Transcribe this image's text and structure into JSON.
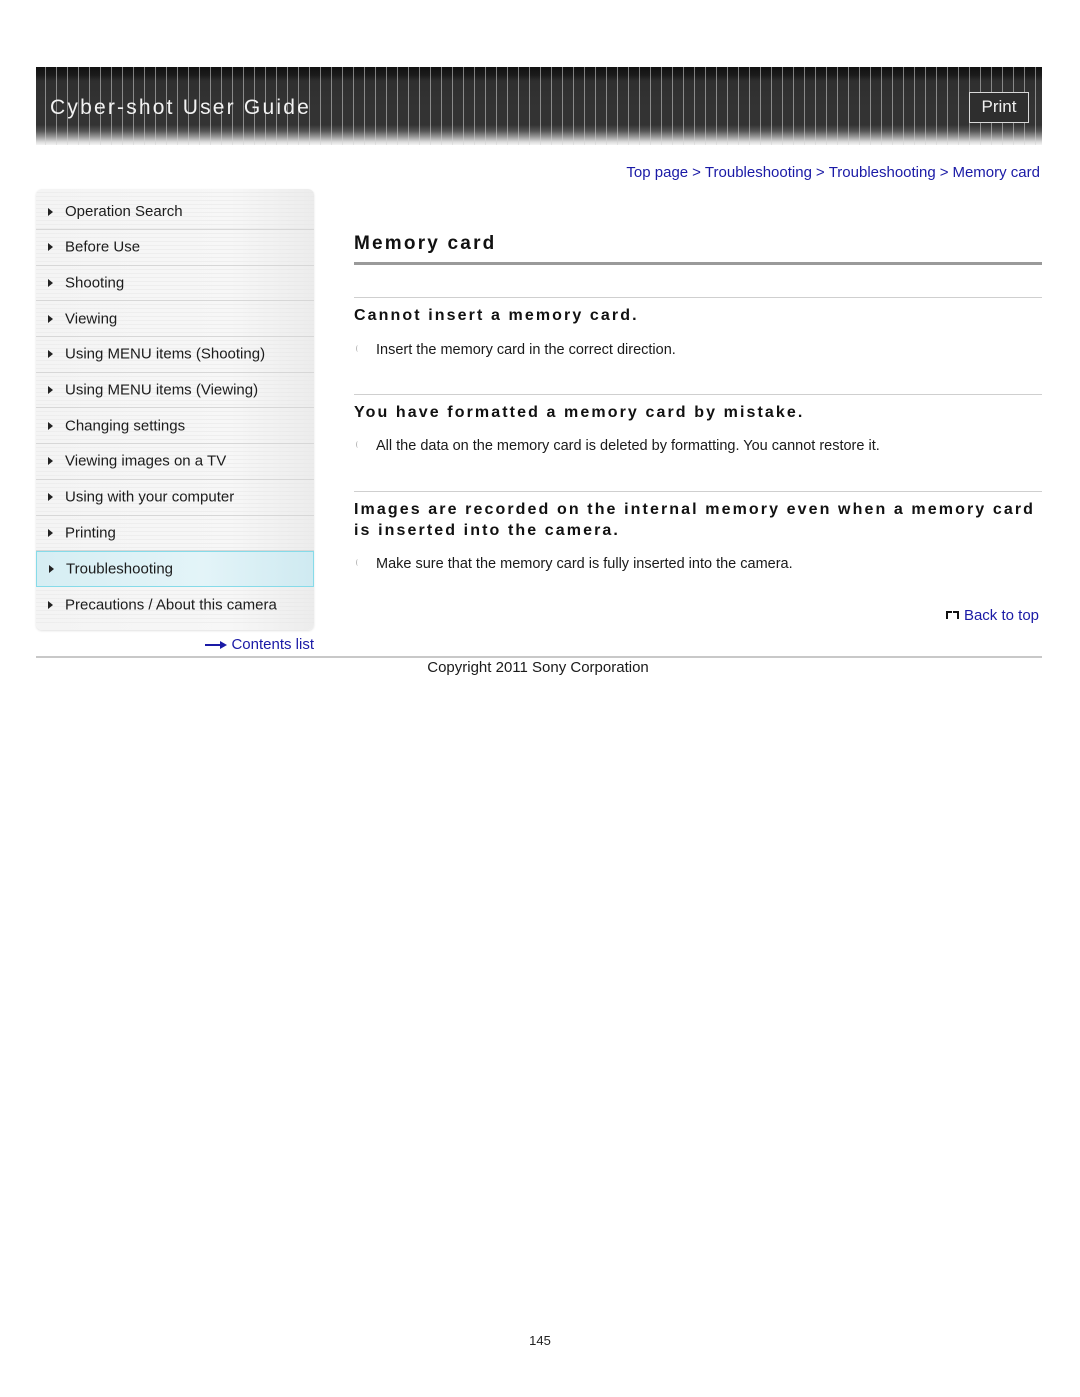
{
  "header": {
    "title": "Cyber-shot User Guide",
    "print_label": "Print"
  },
  "breadcrumb": [
    {
      "label": "Top page"
    },
    {
      "label": "Troubleshooting"
    },
    {
      "label": "Troubleshooting"
    },
    {
      "label": "Memory card"
    }
  ],
  "breadcrumb_separator": ">",
  "sidebar": {
    "items": [
      {
        "label": "Operation Search",
        "active": false
      },
      {
        "label": "Before Use",
        "active": false
      },
      {
        "label": "Shooting",
        "active": false
      },
      {
        "label": "Viewing",
        "active": false
      },
      {
        "label": "Using MENU items (Shooting)",
        "active": false
      },
      {
        "label": "Using MENU items (Viewing)",
        "active": false
      },
      {
        "label": "Changing settings",
        "active": false
      },
      {
        "label": "Viewing images on a TV",
        "active": false
      },
      {
        "label": "Using with your computer",
        "active": false
      },
      {
        "label": "Printing",
        "active": false
      },
      {
        "label": "Troubleshooting",
        "active": true
      },
      {
        "label": "Precautions / About this camera",
        "active": false
      }
    ],
    "contents_link": "Contents list"
  },
  "main": {
    "title": "Memory card",
    "sections": [
      {
        "heading": "Cannot insert a memory card.",
        "bullets": [
          "Insert the memory card in the correct direction."
        ]
      },
      {
        "heading": "You have formatted a memory card by mistake.",
        "bullets": [
          "All the data on the memory card is deleted by formatting. You cannot restore it."
        ]
      },
      {
        "heading": "Images are recorded on the internal memory even when a memory card is inserted into the camera.",
        "bullets": [
          "Make sure that the memory card is fully inserted into the camera."
        ]
      }
    ],
    "back_to_top": "Back to top"
  },
  "footer": {
    "copyright": "Copyright 2011 Sony Corporation",
    "page_number": "145"
  },
  "colors": {
    "link": "#1a1aa6",
    "active_nav_bg": "#d6eef3",
    "active_nav_border": "#86dbe9",
    "banner_bg": "#333333"
  }
}
